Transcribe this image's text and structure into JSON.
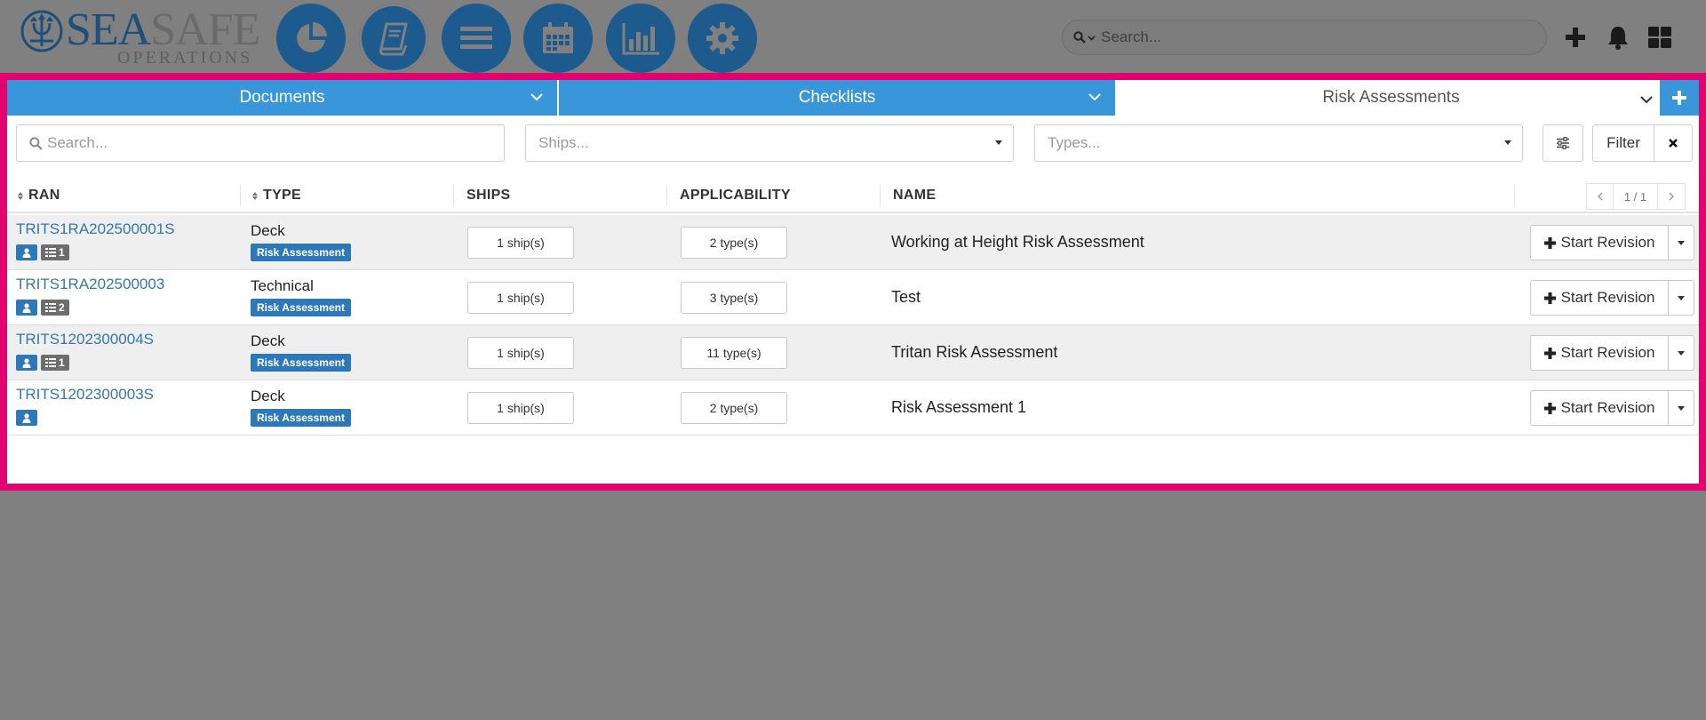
{
  "app": {
    "logo_main": "SEASAFE",
    "logo_main_a": "SEA",
    "logo_main_b": "SAFE",
    "logo_sub": "OPERATIONS"
  },
  "nav": {
    "icons": [
      "pie-chart-icon",
      "book-icon",
      "menu-bars-icon",
      "calendar-icon",
      "bar-chart-icon",
      "gear-icon"
    ]
  },
  "header": {
    "search_placeholder": "Search...",
    "icons": [
      "plus-icon",
      "bell-icon",
      "grid-icon"
    ]
  },
  "tabs": [
    {
      "label": "Documents",
      "active": false
    },
    {
      "label": "Checklists",
      "active": false
    },
    {
      "label": "Risk Assessments",
      "active": true
    }
  ],
  "filters": {
    "search_placeholder": "Search...",
    "ships_placeholder": "Ships...",
    "types_placeholder": "Types...",
    "filter_label": "Filter"
  },
  "table": {
    "columns": [
      "RAN",
      "TYPE",
      "SHIPS",
      "APPLICABILITY",
      "NAME"
    ],
    "pagination": "1 / 1",
    "rows": [
      {
        "ran": "TRITS1RA202500001S",
        "list_count": "1",
        "type": "Deck",
        "type_badge": "Risk Assessment",
        "ships": "1 ship(s)",
        "applicability": "2 type(s)",
        "name": "Working at Height Risk Assessment",
        "action": "Start Revision"
      },
      {
        "ran": "TRITS1RA202500003",
        "list_count": "2",
        "type": "Technical",
        "type_badge": "Risk Assessment",
        "ships": "1 ship(s)",
        "applicability": "3 type(s)",
        "name": "Test",
        "action": "Start Revision"
      },
      {
        "ran": "TRITS1202300004S",
        "list_count": "1",
        "type": "Deck",
        "type_badge": "Risk Assessment",
        "ships": "1 ship(s)",
        "applicability": "11 type(s)",
        "name": "Tritan Risk Assessment",
        "action": "Start Revision"
      },
      {
        "ran": "TRITS1202300003S",
        "list_count": null,
        "type": "Deck",
        "type_badge": "Risk Assessment",
        "ships": "1 ship(s)",
        "applicability": "2 type(s)",
        "name": "Risk Assessment 1",
        "action": "Start Revision"
      }
    ]
  },
  "colors": {
    "tab_blue": "#3a96db",
    "nav_blue": "#1d5a8e",
    "badge_blue": "#2d78b8",
    "link_blue": "#3476b0",
    "panel_border": "#e3006f"
  }
}
